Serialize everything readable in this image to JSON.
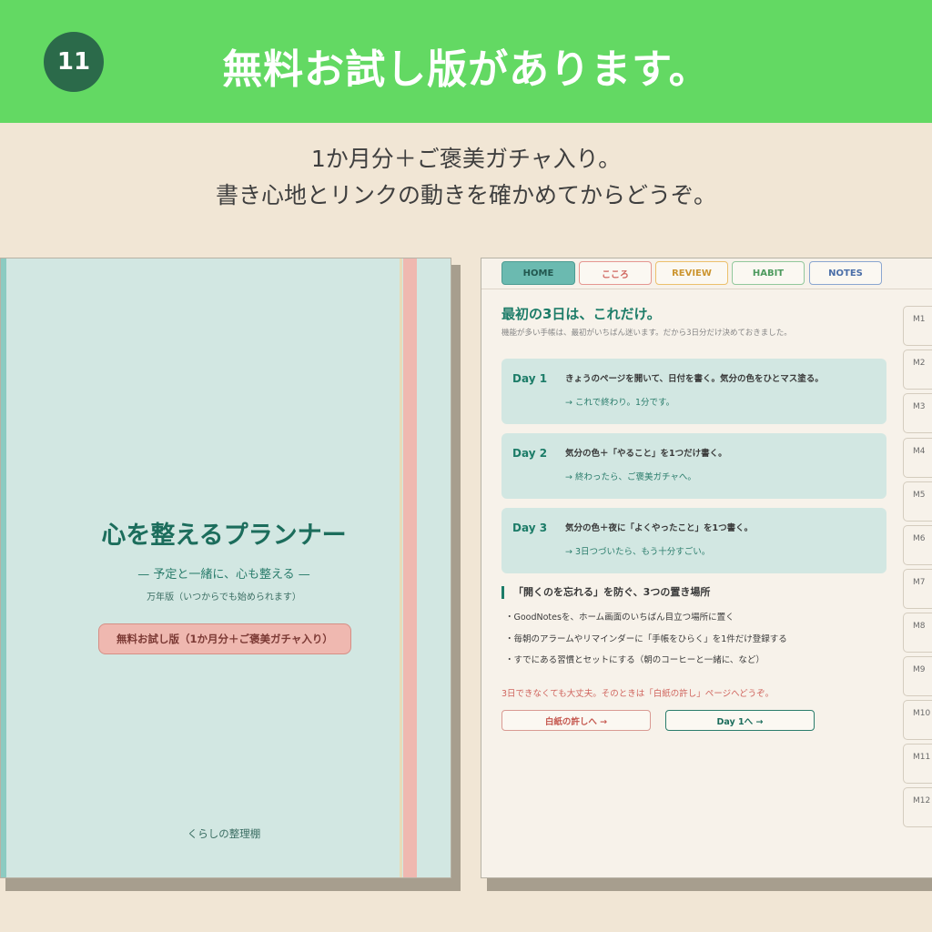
{
  "banner": {
    "number": "11",
    "title": "無料お試し版があります。"
  },
  "subtitle": {
    "line1": "1か月分＋ご褒美ガチャ入り。",
    "line2": "書き心地とリンクの動きを確かめてからどうぞ。"
  },
  "cover": {
    "title": "心を整えるプランナー",
    "tagline": "— 予定と一緒に、心も整える —",
    "edition": "万年版（いつからでも始められます）",
    "trial_label": "無料お試し版（1か月分＋ご褒美ガチャ入り）",
    "author": "くらしの整理棚"
  },
  "planner": {
    "tabs": [
      "HOME",
      "こころ",
      "REVIEW",
      "HABIT",
      "NOTES"
    ],
    "title": "最初の3日は、これだけ。",
    "subtitle": "機能が多い手帳は、最初がいちばん迷います。だから3日分だけ決めておきました。",
    "days": [
      {
        "label": "Day 1",
        "main": "きょうのページを開いて、日付を書く。気分の色をひとマス塗る。",
        "note": "→ これで終わり。1分です。"
      },
      {
        "label": "Day 2",
        "main": "気分の色＋「やること」を1つだけ書く。",
        "note": "→ 終わったら、ご褒美ガチャへ。"
      },
      {
        "label": "Day 3",
        "main": "気分の色＋夜に「よくやったこと」を1つ書く。",
        "note": "→ 3日つづいたら、もう十分すごい。"
      }
    ],
    "section_title": "「開くのを忘れる」を防ぐ、3つの置き場所",
    "bullets": [
      "・GoodNotesを、ホーム画面のいちばん目立つ場所に置く",
      "・毎朝のアラームやリマインダーに「手帳をひらく」を1件だけ登録する",
      "・すでにある習慣とセットにする（朝のコーヒーと一緒に、など）"
    ],
    "note": "3日できなくても大丈夫。そのときは「白紙の許し」ページへどうぞ。",
    "btn_blank": "白紙の許しへ →",
    "btn_day1": "Day 1へ →",
    "month_tabs": [
      "M1",
      "M2",
      "M3",
      "M4",
      "M5",
      "M6",
      "M7",
      "M8",
      "M9",
      "M10",
      "M11",
      "M12"
    ]
  }
}
